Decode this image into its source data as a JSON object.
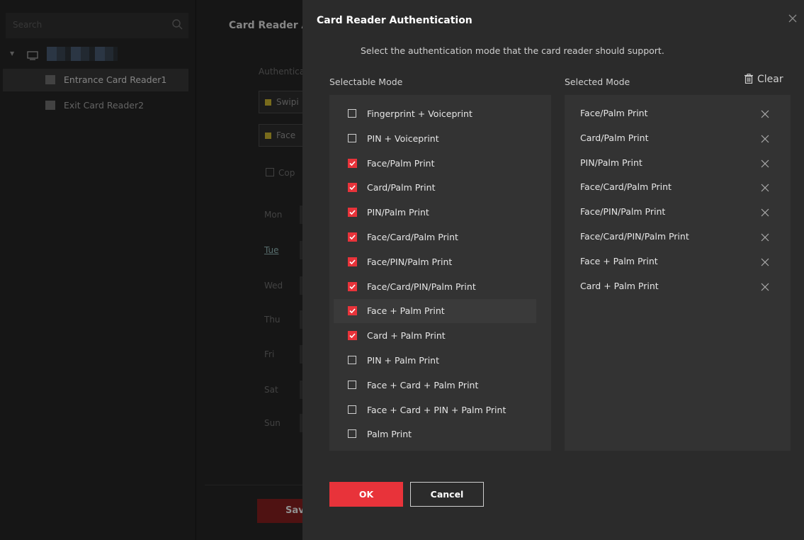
{
  "sidebar": {
    "search_placeholder": "Search",
    "readers": [
      "Entrance Card Reader1",
      "Exit Card Reader2"
    ]
  },
  "main": {
    "title": "Card Reader A",
    "authentication_label": "Authentica",
    "mode_chips": [
      "Swipi",
      "Face"
    ],
    "copy_label": "Cop",
    "days": [
      "Mon",
      "Tue",
      "Wed",
      "Thu",
      "Fri",
      "Sat",
      "Sun"
    ],
    "save_label": "Save"
  },
  "dialog": {
    "title": "Card Reader Authentication",
    "subtitle": "Select the authentication mode that the card reader should support.",
    "selectable_title": "Selectable Mode",
    "selected_title": "Selected Mode",
    "clear_label": "Clear",
    "selectable_modes": [
      {
        "label": "Fingerprint + Voiceprint",
        "checked": false
      },
      {
        "label": "PIN + Voiceprint",
        "checked": false
      },
      {
        "label": "Face/Palm Print",
        "checked": true
      },
      {
        "label": "Card/Palm Print",
        "checked": true
      },
      {
        "label": "PIN/Palm Print",
        "checked": true
      },
      {
        "label": "Face/Card/Palm Print",
        "checked": true
      },
      {
        "label": "Face/PIN/Palm Print",
        "checked": true
      },
      {
        "label": "Face/Card/PIN/Palm Print",
        "checked": true
      },
      {
        "label": "Face + Palm Print",
        "checked": true
      },
      {
        "label": "Card + Palm Print",
        "checked": true
      },
      {
        "label": "PIN + Palm Print",
        "checked": false
      },
      {
        "label": "Face + Card + Palm Print",
        "checked": false
      },
      {
        "label": "Face + Card + PIN + Palm Print",
        "checked": false
      },
      {
        "label": "Palm Print",
        "checked": false
      }
    ],
    "selected_modes": [
      "Face/Palm Print",
      "Card/Palm Print",
      "PIN/Palm Print",
      "Face/Card/Palm Print",
      "Face/PIN/Palm Print",
      "Face/Card/PIN/Palm Print",
      "Face + Palm Print",
      "Card + Palm Print"
    ],
    "ok_label": "OK",
    "cancel_label": "Cancel"
  },
  "colors": {
    "accent": "#e8333a",
    "dialog_bg": "#2b2b2b",
    "panel_bg": "#333333"
  }
}
